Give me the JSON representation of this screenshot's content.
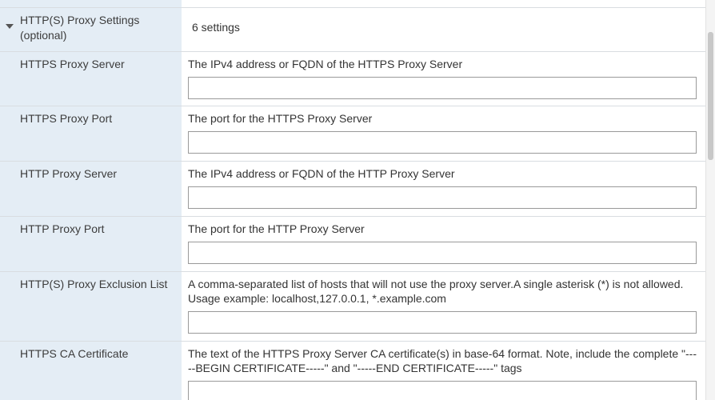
{
  "group": {
    "title": "HTTP(S) Proxy Settings (optional)",
    "summary": "6 settings"
  },
  "settings": [
    {
      "label": "HTTPS Proxy Server",
      "description": "The IPv4 address or FQDN of the HTTPS Proxy Server",
      "value": ""
    },
    {
      "label": "HTTPS Proxy Port",
      "description": "The port for the HTTPS Proxy Server",
      "value": ""
    },
    {
      "label": "HTTP Proxy Server",
      "description": "The IPv4 address or FQDN of the HTTP Proxy Server",
      "value": ""
    },
    {
      "label": "HTTP Proxy Port",
      "description": "The port for the HTTP Proxy Server",
      "value": ""
    },
    {
      "label": "HTTP(S) Proxy Exclusion List",
      "description": "A comma-separated list of hosts that will not use the proxy server.A single asterisk (*) is not allowed. Usage example: localhost,127.0.0.1, *.example.com",
      "value": ""
    },
    {
      "label": "HTTPS CA Certificate",
      "description": "The text of the HTTPS Proxy Server CA certificate(s) in base-64 format. Note, include the complete \"-----BEGIN CERTIFICATE-----\" and \"-----END CERTIFICATE-----\" tags",
      "value": ""
    }
  ],
  "icons": {
    "collapse": "caret-down-icon"
  },
  "colors": {
    "label_background": "#e4edf5",
    "row_border": "#d9dde1",
    "input_border": "#9a9a9a"
  }
}
